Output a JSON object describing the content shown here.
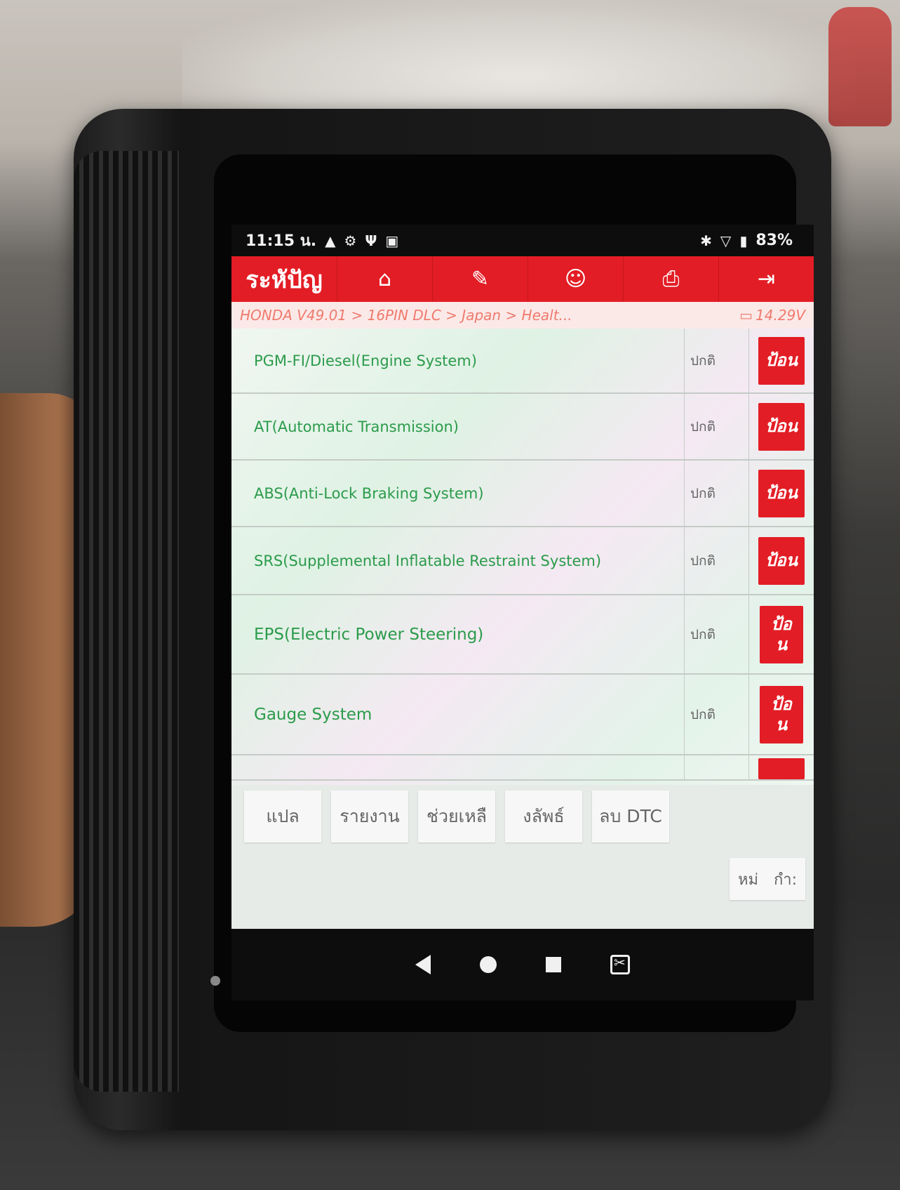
{
  "status_bar": {
    "time": "11:15 น.",
    "left_icons": [
      "warning-icon",
      "settings-badge-icon",
      "usb-icon",
      "image-icon"
    ],
    "right_icons": [
      "bluetooth-icon",
      "wifi-icon",
      "battery-icon"
    ],
    "battery": "83%"
  },
  "app_bar": {
    "title": "ระหัปัญ",
    "buttons": [
      "home-icon",
      "edit-note-icon",
      "user-support-icon",
      "print-icon",
      "exit-icon"
    ],
    "accent": "#e31d25"
  },
  "breadcrumb": {
    "path": "HONDA V49.01 > 16PIN DLC > Japan > Healt...",
    "voltage": "14.29V"
  },
  "systems": [
    {
      "name": "PGM-FI/Diesel(Engine System)",
      "status": "ปกติ",
      "action": "ป้อน"
    },
    {
      "name": "AT(Automatic Transmission)",
      "status": "ปกติ",
      "action": "ป้อน"
    },
    {
      "name": "ABS(Anti-Lock Braking System)",
      "status": "ปกติ",
      "action": "ป้อน"
    },
    {
      "name": "SRS(Supplemental Inflatable Restraint System)",
      "status": "ปกติ",
      "action": "ป้อน"
    },
    {
      "name": "EPS(Electric Power Steering)",
      "status": "ปกติ",
      "action": "ป้อน"
    },
    {
      "name": "Gauge System",
      "status": "ปกติ",
      "action": "ป้อน"
    }
  ],
  "footer": {
    "buttons": [
      "แปล",
      "รายงาน",
      "ช่วยเหลื",
      "งลัพธ์",
      "ลบ DTC"
    ],
    "secondary_left": "หม่",
    "secondary_right": "กำ:"
  }
}
